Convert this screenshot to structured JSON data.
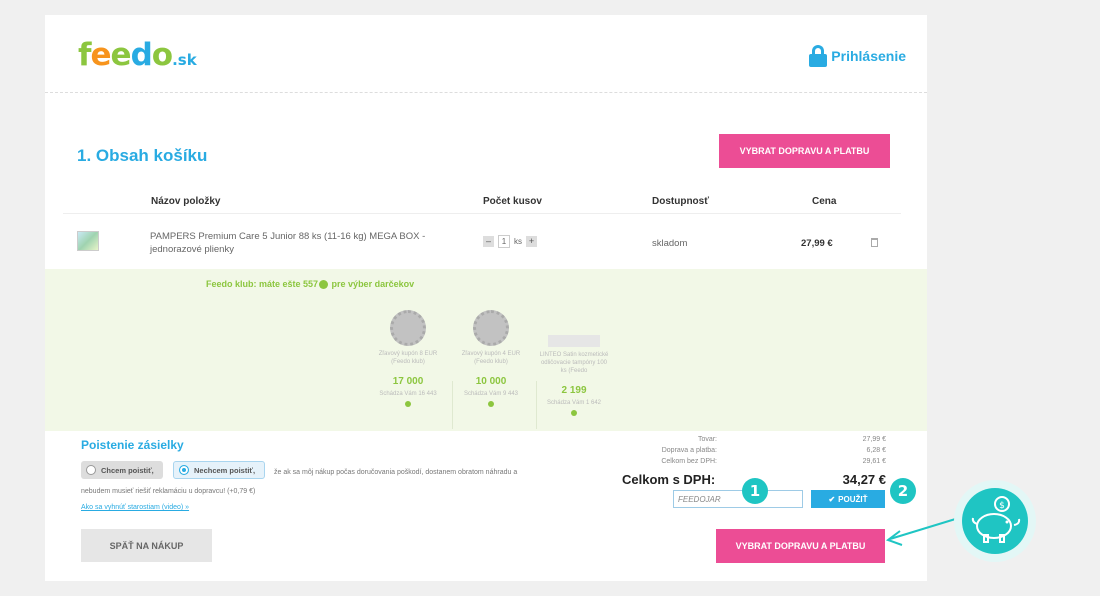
{
  "header": {
    "logo_f": "f",
    "logo_e1": "e",
    "logo_e2": "e",
    "logo_d": "d",
    "logo_o": "o",
    "logo_sk": ".sk",
    "login_label": "Prihlásenie"
  },
  "cart": {
    "title": "1. Obsah košíku",
    "checkout_button": "VYBRAT DOPRAVU A PLATBU",
    "columns": [
      "Názov položky",
      "Počet kusov",
      "Dostupnosť",
      "Cena"
    ],
    "items": [
      {
        "name": "PAMPERS Premium Care 5 Junior 88 ks (11-16 kg) MEGA BOX - jednorazové plienky",
        "quantity": "1",
        "unit": "ks",
        "availability": "skladom",
        "price": "27,99 €"
      }
    ],
    "qty_minus": "–",
    "qty_plus": "+"
  },
  "club": {
    "title_prefix": "Feedo klub: máte ešte 557",
    "title_suffix": " pre výber darčekov",
    "gifts": [
      {
        "name": "Zľavový kupón 8 EUR (Feedo klub)",
        "points": "17 000",
        "missing": "Schádza Vám 16 443"
      },
      {
        "name": "Zľavový kupón 4 EUR (Feedo klub)",
        "points": "10 000",
        "missing": "Schádza Vám 9 443"
      },
      {
        "name": "LINTEO Satin kozmetické odličovacie tampóny 100 ks (Feedo",
        "points": "2 199",
        "missing": "Schádza Vám 1 642"
      }
    ]
  },
  "insurance": {
    "title": "Poistenie zásielky",
    "option_yes": "Chcem poistiť,",
    "option_no": "Nechcem poistiť,",
    "selected": "no",
    "description": "že ak sa môj nákup počas doručovania poškodí, dostanem obratom náhradu a nebudem musieť riešiť reklamáciu u dopravcu! (+0,79 €)",
    "link": "Ako sa vyhnúť starostiam (video) »"
  },
  "back_button": "SPÄŤ NA NÁKUP",
  "summary": {
    "goods_label": "Tovar:",
    "goods_value": "27,99 €",
    "shipping_label": "Doprava a platba:",
    "shipping_value": "6,28 €",
    "net_label": "Celkom bez DPH:",
    "net_value": "29,61 €",
    "total_label": "Celkom s DPH:",
    "total_value": "34,27 €"
  },
  "coupon": {
    "value": "FEEDOJAR",
    "apply_label": "POUŽIŤ"
  },
  "annotations": {
    "marker_1": "1",
    "marker_2": "2"
  },
  "colors": {
    "brand_blue": "#29abe2",
    "brand_pink": "#ec4d95",
    "brand_green": "#8cc63f",
    "marker_teal": "#1fc5c3"
  }
}
